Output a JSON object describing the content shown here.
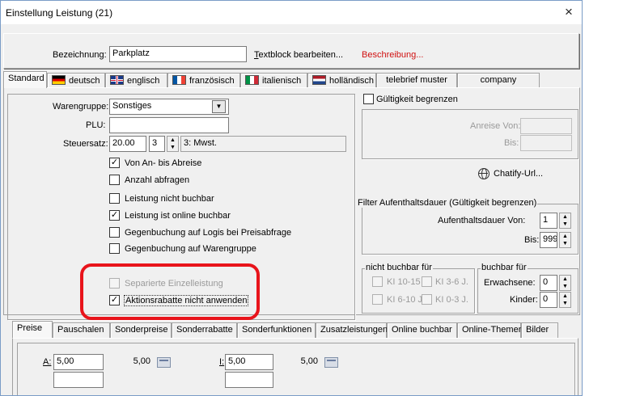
{
  "window": {
    "title": "Einstellung Leistung (21)",
    "close": "×"
  },
  "header": {
    "bezeichnung_label": "Bezeichnung:",
    "bezeichnung_value": "Parkplatz",
    "textblock_link": "Textblock bearbeiten...",
    "beschreibung_link": "Beschreibung..."
  },
  "tabs_top": [
    {
      "label": "Standard"
    },
    {
      "label": "deutsch",
      "flag": "de-flag"
    },
    {
      "label": "englisch",
      "flag": "uk-flag"
    },
    {
      "label": "französisch",
      "flag": "fr-flag"
    },
    {
      "label": "italienisch",
      "flag": "it-flag"
    },
    {
      "label": "holländisch",
      "flag": "nl-flag"
    },
    {
      "label": "telebrief muster"
    },
    {
      "label": "company"
    }
  ],
  "form": {
    "warengruppe_label": "Warengruppe:",
    "warengruppe_value": "Sonstiges",
    "plu_label": "PLU:",
    "plu_value": "",
    "steuersatz_label": "Steuersatz:",
    "steuersatz_value": "20.00",
    "steuer_num": "3",
    "steuer_desc": "3: Mwst."
  },
  "checkboxes": [
    {
      "label": "Von An- bis Abreise",
      "checked": true
    },
    {
      "label": "Anzahl abfragen",
      "checked": false
    },
    {
      "label": "Leistung nicht buchbar",
      "checked": false
    },
    {
      "label": "Leistung ist online buchbar",
      "checked": true
    },
    {
      "label": "Gegenbuchung auf Logis bei Preisabfrage",
      "checked": false
    },
    {
      "label": "Gegenbuchung auf Warengruppe",
      "checked": false
    },
    {
      "label": "Separierte Einzelleistung",
      "checked": false,
      "disabled": true
    },
    {
      "label": "Aktionsrabatte nicht anwenden",
      "checked": true
    }
  ],
  "gueltigkeit": {
    "checkbox_label": "Gültigkeit begrenzen",
    "anreise_label": "Anreise Von:",
    "bis_label": "Bis:"
  },
  "chatify": {
    "label": "Chatify-Url..."
  },
  "aufenthalt": {
    "group_label": "Filter Aufenthaltsdauer (Gültigkeit begrenzen)",
    "von_label": "Aufenthaltsdauer Von:",
    "von_value": "1",
    "bis_label": "Bis:",
    "bis_value": "999"
  },
  "nicht_buchbar": {
    "group_label": "nicht buchbar für",
    "items": [
      "KI 10-15",
      "KI 3-6 J.",
      "KI 6-10 J.",
      "KI 0-3 J."
    ]
  },
  "buchbar": {
    "group_label": "buchbar für",
    "erwachsene_label": "Erwachsene:",
    "erwachsene_value": "0",
    "kinder_label": "Kinder:",
    "kinder_value": "0"
  },
  "tabs_bottom": [
    "Preise",
    "Pauschalen",
    "Sonderpreise",
    "Sonderrabatte",
    "Sonderfunktionen",
    "Zusatzleistungen",
    "Online buchbar",
    "Online-Themen",
    "Bilder"
  ],
  "prices": {
    "a_label": "A:",
    "a_value1": "5,00",
    "a_value2": "5,00",
    "i_label": "I:",
    "i_value1": "5,00",
    "i_value2": "5,00"
  },
  "colors": {
    "highlight": "#e8141b",
    "link_red": "#d01010"
  }
}
